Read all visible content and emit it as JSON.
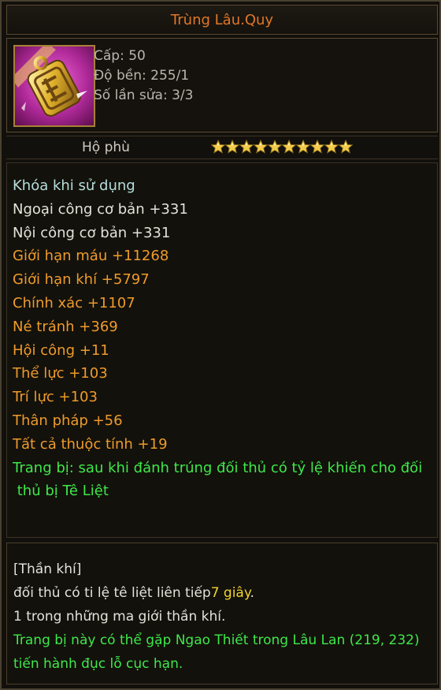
{
  "item": {
    "name": "Trùng Lâu.Quy",
    "level": "Cấp: 50",
    "durability": "Độ bền: 255/1",
    "repairs": "Số lần sửa: 3/3",
    "icon": "golden-amulet-icon",
    "type": "Hộ phù",
    "stars": 10
  },
  "attributes": [
    {
      "text": "Khóa khi sử dụng",
      "color": "cyan"
    },
    {
      "text": "Ngoại công cơ bản +331",
      "color": "white"
    },
    {
      "text": "Nội công cơ bản +331",
      "color": "white"
    },
    {
      "text": "Giới hạn máu +11268",
      "color": "orange"
    },
    {
      "text": "Giới hạn khí +5797",
      "color": "orange"
    },
    {
      "text": "Chính xác +1107",
      "color": "orange"
    },
    {
      "text": "Né tránh +369",
      "color": "orange"
    },
    {
      "text": "Hội công +11",
      "color": "orange"
    },
    {
      "text": "Thể lực +103",
      "color": "orange"
    },
    {
      "text": "Trí lực +103",
      "color": "orange"
    },
    {
      "text": "Thân pháp +56",
      "color": "orange"
    },
    {
      "text": "Tất cả thuộc tính +19",
      "color": "orange"
    },
    {
      "text": "Trang bị: sau khi đánh trúng đối thủ có tỷ lệ khiến cho đối",
      "color": "green"
    },
    {
      "text": " thủ bị Tê Liệt",
      "color": "green"
    }
  ],
  "description": {
    "header": "[Thần khí]",
    "line1": "đối thủ có ti lệ tê liệt liên tiếp",
    "line1_highlight": "7 giây",
    "line1_end": ".",
    "line2": "1 trong những ma giới thần khí.",
    "line3": "Trang bị này có thể gặp Ngao Thiết trong Lâu Lan (219, 232)",
    "line4": " tiến hành đục lỗ cục hạn."
  },
  "colors": {
    "title": "#e07828",
    "cyan": "#b6dedc",
    "white": "#e4e1d8",
    "orange": "#ee9b2a",
    "green": "#3ee84a",
    "yellow": "#f2d32c",
    "border": "#5a4a32"
  }
}
